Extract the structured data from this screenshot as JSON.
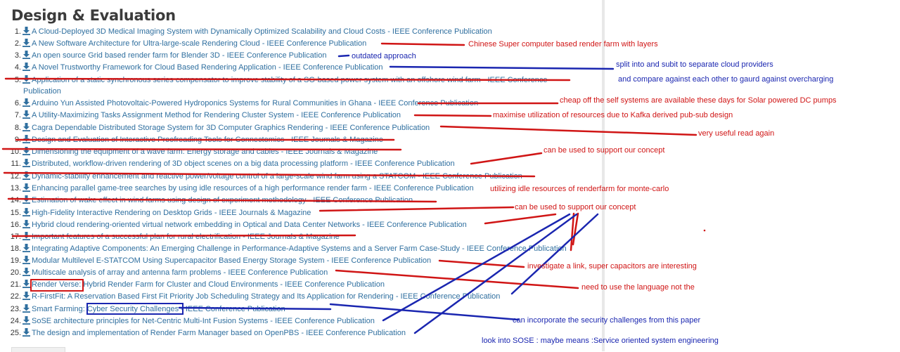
{
  "section": {
    "title": "Design & Evaluation"
  },
  "publications": [
    {
      "number": "1.",
      "title": "A Cloud-Deployed 3D Medical Imaging System with Dynamically Optimized Scalability and Cloud Costs - IEEE Conference Publication"
    },
    {
      "number": "2.",
      "title": "A New Software Architecture for Ultra-large-scale Rendering Cloud - IEEE Conference Publication"
    },
    {
      "number": "3.",
      "title": "An open source Grid based render farm for Blender 3D - IEEE Conference Publication"
    },
    {
      "number": "4.",
      "title": "A Novel Trustworthy Framework for Cloud Based Rendering Application - IEEE Conference Publication"
    },
    {
      "number": "5.",
      "title": "Application of a static synchronous series compensator to improve stability of a SG-based power system with an offshore wind farm - IEEE Conference",
      "continuation": "Publication"
    },
    {
      "number": "6.",
      "title": "Arduino Yun Assisted Photovoltaic-Powered Hydroponics Systems for Rural Communities in Ghana - IEEE Conference Publication"
    },
    {
      "number": "7.",
      "title": "A Utility-Maximizing Tasks Assignment Method for Rendering Cluster System - IEEE Conference Publication"
    },
    {
      "number": "8.",
      "title": "Cagra Dependable Distributed Storage System for 3D Computer Graphics Rendering - IEEE Conference Publication"
    },
    {
      "number": "9.",
      "title": "Design and Evaluation of Interactive Proofreading Tools for Connectomics - IEEE Journals & Magazine"
    },
    {
      "number": "10.",
      "title": "Dimensioning the equipment of a wave farm: Energy storage and cables - IEEE Journals & Magazine"
    },
    {
      "number": "11.",
      "title": "Distributed, workflow-driven rendering of 3D object scenes on a big data processing platform - IEEE Conference Publication"
    },
    {
      "number": "12.",
      "title": "Dynamic-stability enhancement and reactive power/voltage control of a large-scale wind farm using a STATCOM - IEEE Conference Publication"
    },
    {
      "number": "13.",
      "title": "Enhancing parallel game-tree searches by using idle resources of a high performance render farm - IEEE Conference Publication"
    },
    {
      "number": "14.",
      "title": "Estimation of wake effect in wind farms using design of experiment methodology - IEEE Conference Publication"
    },
    {
      "number": "15.",
      "title": "High-Fidelity Interactive Rendering on Desktop Grids - IEEE Journals & Magazine"
    },
    {
      "number": "16.",
      "title": "Hybrid cloud rendering-oriented virtual network embedding in Optical and Data Center Networks - IEEE Conference Publication"
    },
    {
      "number": "17.",
      "title": "Important features of a successful plan for rural electrification - IEEE Journals & Magazine"
    },
    {
      "number": "18.",
      "title": "Integrating Adaptive Components: An Emerging Challenge in Performance-Adaptive Systems and a Server Farm Case-Study - IEEE Conference Publication"
    },
    {
      "number": "19.",
      "title": "Modular Multilevel E-STATCOM Using Supercapacitor Based Energy Storage System - IEEE Conference Publication"
    },
    {
      "number": "20.",
      "title": "Multiscale analysis of array and antenna farm problems - IEEE Conference Publication"
    },
    {
      "number": "21.",
      "title": "Render Verse: Hybrid Render Farm for Cluster and Cloud Environments - IEEE Conference Publication"
    },
    {
      "number": "22.",
      "title": "R-FirstFit: A Reservation Based First Fit Priority Job Scheduling Strategy and Its Application for Rendering - IEEE Conference Publication"
    },
    {
      "number": "23.",
      "title": "Smart Farming: Cyber Security Challenges - IEEE Conference Publication"
    },
    {
      "number": "24.",
      "title": "SoSE architecture principles for Net-Centric Multi-Int Fusion Systems - IEEE Conference Publication"
    },
    {
      "number": "25.",
      "title": "The design and implementation of Render Farm Manager based on OpenPBS - IEEE Conference Publication"
    }
  ],
  "annotations": [
    {
      "text": "Chinese Super computer based render farm with layers",
      "color": "red"
    },
    {
      "text": "outdated approach",
      "color": "blue"
    },
    {
      "text": "split into and subit to separate cloud providers",
      "color": "blue"
    },
    {
      "text": "and compare against each other to gaurd against overcharging",
      "color": "blue"
    },
    {
      "text": "cheap off the self systems are available these days for Solar powered DC pumps",
      "color": "red"
    },
    {
      "text": "maximise utilization of resources due to Kafka derived pub-sub design",
      "color": "red"
    },
    {
      "text": "very useful read again",
      "color": "red"
    },
    {
      "text": "can be used to support our concept",
      "color": "red"
    },
    {
      "text": "utilizing idle resources of renderfarm for monte-carlo",
      "color": "red"
    },
    {
      "text": "can be used to support our concept",
      "color": "red"
    },
    {
      "text": "investigate a link, super capacitors are interesting",
      "color": "red"
    },
    {
      "text": "need to use the language not the",
      "color": "red"
    },
    {
      "text": "can incorporate the security challenges from this paper",
      "color": "blue"
    },
    {
      "text": "look into SOSE : maybe means :Service oriented system engineering",
      "color": "blue"
    }
  ],
  "colors": {
    "link": "#2f6f9f",
    "red_ink": "#d01515",
    "blue_ink": "#1a26b0"
  },
  "icons": {
    "list_item_icon": "download-icon"
  }
}
